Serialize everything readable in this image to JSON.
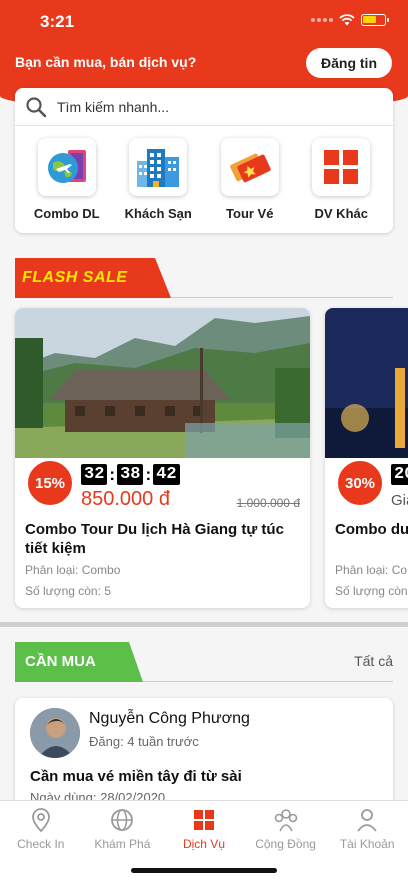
{
  "status_bar": {
    "time": "3:21"
  },
  "header": {
    "title": "Bạn cần mua, bán dịch vụ?",
    "post_button": "Đăng tin"
  },
  "search": {
    "placeholder": "Tìm kiếm nhanh..."
  },
  "categories": [
    {
      "label": "Combo DL",
      "icon": "combo-travel-icon"
    },
    {
      "label": "Khách Sạn",
      "icon": "hotel-icon"
    },
    {
      "label": "Tour Vé",
      "icon": "ticket-icon"
    },
    {
      "label": "DV Khác",
      "icon": "grid-icon"
    }
  ],
  "flash_sale": {
    "label": "FLASH SALE",
    "items": [
      {
        "discount": "15%",
        "timer": {
          "h": "32",
          "m": "38",
          "s": "42"
        },
        "price": "850.000 đ",
        "old_price": "1.000.000 đ",
        "title": "Combo Tour Du lịch Hà Giang tự túc tiết kiệm",
        "category": "Phân loại: Combo",
        "quantity": "Số lượng còn: 5"
      },
      {
        "discount": "30%",
        "timer": {
          "h": "20"
        },
        "price": "Gia",
        "title": "Combo du đáy",
        "category": "Phân loại: Co",
        "quantity": "Số lượng còn"
      }
    ]
  },
  "buy_section": {
    "label": "CẦN MUA",
    "see_all": "Tất cả",
    "post": {
      "name": "Nguyễn Công Phương",
      "time": "Đăng: 4 tuần trước",
      "title": "Cần mua vé miền tây đi từ sài",
      "date": "Ngày dùng: 28/02/2020"
    }
  },
  "tabs": [
    {
      "label": "Check In",
      "icon": "location-pin-icon",
      "active": false
    },
    {
      "label": "Khám Phá",
      "icon": "globe-icon",
      "active": false
    },
    {
      "label": "Dịch Vụ",
      "icon": "grid-icon",
      "active": true
    },
    {
      "label": "Cộng Đồng",
      "icon": "community-icon",
      "active": false
    },
    {
      "label": "Tài Khoản",
      "icon": "user-icon",
      "active": false
    }
  ],
  "colors": {
    "brand": "#e8391d",
    "flash_text": "#ffe600",
    "buy_green": "#5cbf4a"
  }
}
